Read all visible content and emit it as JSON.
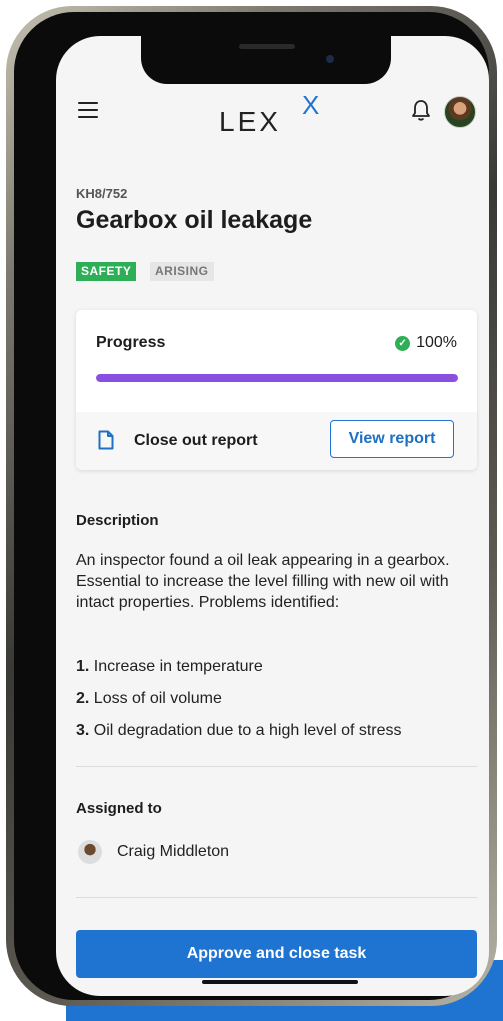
{
  "app": {
    "logo_text": "LEX",
    "logo_superscript": "X"
  },
  "task": {
    "id": "KH8/752",
    "title": "Gearbox oil leakage",
    "badges": [
      "SAFETY",
      "ARISING"
    ]
  },
  "progress": {
    "label": "Progress",
    "percent_text": "100%",
    "percent_value": 100
  },
  "report": {
    "label": "Close out report",
    "button_label": "View report"
  },
  "description": {
    "heading": "Description",
    "text": "An inspector found a oil leak appearing in a gearbox. Essential to increase the level filling with new oil with intact properties. Problems identified:",
    "problems": [
      {
        "number": "1.",
        "text": " Increase in temperature"
      },
      {
        "number": "2.",
        "text": " Loss of oil volume"
      },
      {
        "number": "3.",
        "text": " Oil degradation due to a high level of stress"
      }
    ]
  },
  "assignment": {
    "heading": "Assigned to",
    "assignee": "Craig Middleton"
  },
  "actions": {
    "approve_label": "Approve and close task"
  },
  "colors": {
    "accent": "#1f74d1",
    "safety": "#2eae56",
    "progress": "#8a4fe0"
  }
}
